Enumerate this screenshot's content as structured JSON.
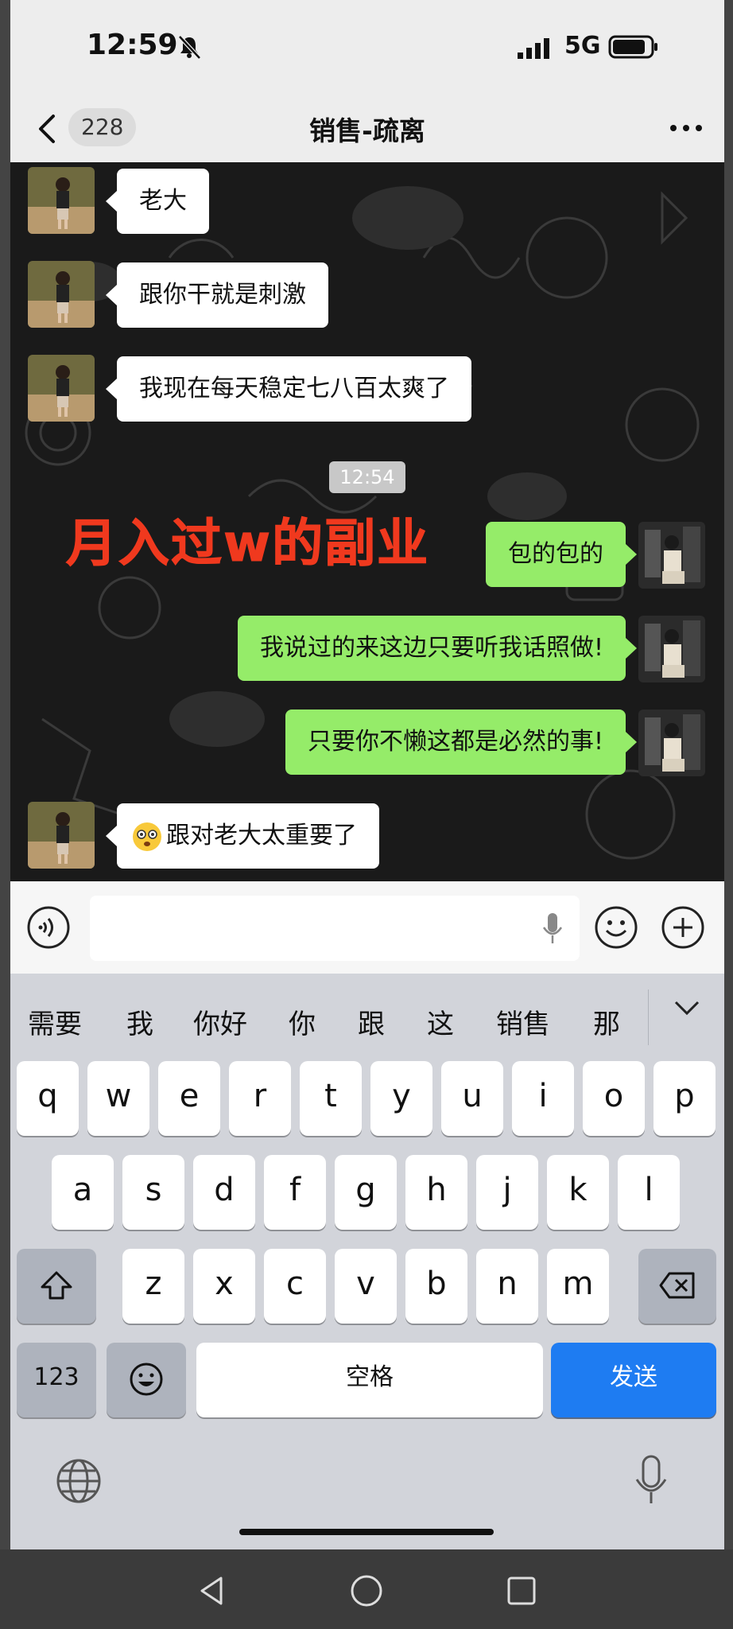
{
  "status_bar": {
    "time": "12:59",
    "network": "5G"
  },
  "header": {
    "back_count": "228",
    "title": "销售-疏离"
  },
  "messages": {
    "m1": "老大",
    "m2": "跟你干就是刺激",
    "m3": "我现在每天稳定七八百太爽了",
    "timestamp": "12:54",
    "m4": "包的包的",
    "m5": "我说过的来这边只要听我话照做!",
    "m6": "只要你不懒这都是必然的事!",
    "m7": "跟对老大太重要了"
  },
  "overlay_text": "月入过w的副业",
  "suggestions": [
    "需要",
    "我",
    "你好",
    "你",
    "跟",
    "这",
    "销售",
    "那"
  ],
  "keyboard": {
    "row1": [
      "q",
      "w",
      "e",
      "r",
      "t",
      "y",
      "u",
      "i",
      "o",
      "p"
    ],
    "row2": [
      "a",
      "s",
      "d",
      "f",
      "g",
      "h",
      "j",
      "k",
      "l"
    ],
    "row3": [
      "z",
      "x",
      "c",
      "v",
      "b",
      "n",
      "m"
    ],
    "num_key": "123",
    "space_label": "空格",
    "send_label": "发送"
  },
  "colors": {
    "green_bubble": "#95ec69",
    "send_blue": "#1e7cf2",
    "overlay_red": "#f0391e"
  }
}
